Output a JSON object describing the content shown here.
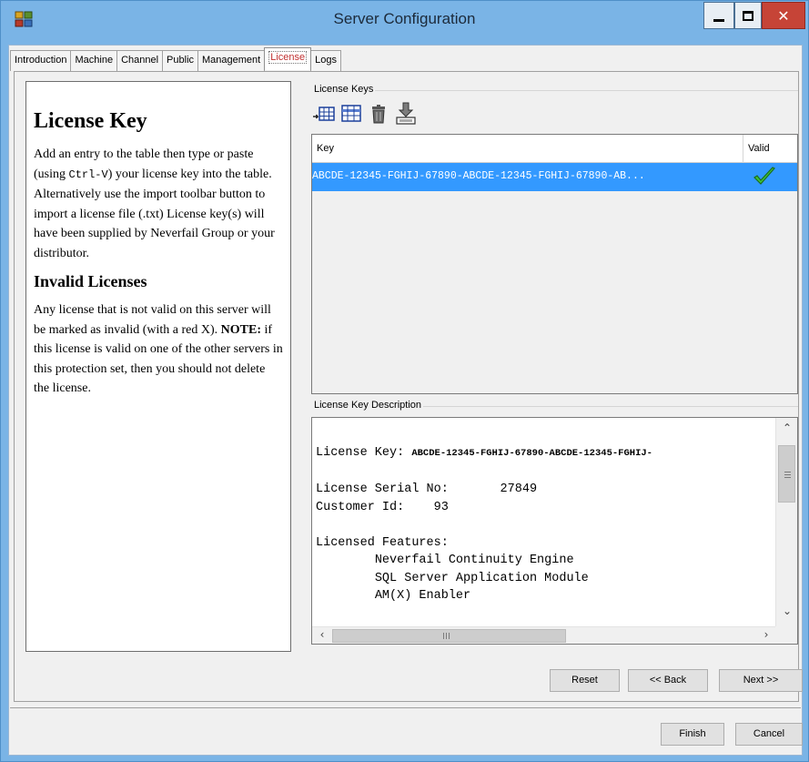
{
  "window": {
    "title": "Server Configuration"
  },
  "tabs": [
    {
      "label": "Introduction"
    },
    {
      "label": "Machine"
    },
    {
      "label": "Channel"
    },
    {
      "label": "Public"
    },
    {
      "label": "Management"
    },
    {
      "label": "License",
      "active": true
    },
    {
      "label": "Logs"
    }
  ],
  "help": {
    "heading": "License Key",
    "intro_1": "Add an entry to the table then type or paste (using ",
    "intro_shortcut": "Ctrl-V",
    "intro_2": ") your license key into the table. Alternatively use the import toolbar button to import a license file (.txt) License key(s) will have been supplied by Neverfail Group or your distributor.",
    "invalid_heading": "Invalid Licenses",
    "invalid_1": "Any license that is not valid on this server will be marked as invalid (with a red X). ",
    "invalid_note": "NOTE:",
    "invalid_2": " if this license is valid on one of the other servers in this protection set, then you should not delete the license."
  },
  "license_keys": {
    "group_label": "License Keys",
    "toolbar": [
      {
        "icon": "add-row-icon"
      },
      {
        "icon": "edit-row-icon"
      },
      {
        "icon": "delete-icon"
      },
      {
        "icon": "import-icon"
      }
    ],
    "columns": {
      "key": "Key",
      "valid": "Valid"
    },
    "rows": [
      {
        "key": "ABCDE-12345-FGHIJ-67890-ABCDE-12345-FGHIJ-67890-AB...",
        "valid": true
      }
    ]
  },
  "description": {
    "group_label": "License Key Description",
    "key_label": "License Key: ",
    "key_value": "ABCDE-12345-FGHIJ-67890-ABCDE-12345-FGHIJ-",
    "serial_line": "License Serial No:       27849",
    "customer_line": "Customer Id:    93",
    "features_label": "Licensed Features:",
    "features": [
      "Neverfail Continuity Engine",
      "SQL Server Application Module",
      "AM(X) Enabler"
    ]
  },
  "buttons": {
    "reset": "Reset",
    "back": "<< Back",
    "next": "Next >>",
    "finish": "Finish",
    "cancel": "Cancel"
  },
  "colors": {
    "title_bar": "#7ab4e6",
    "selection": "#3399ff",
    "active_tab_text": "#c03030",
    "close_button": "#c64437",
    "valid_check": "#3cc43c"
  }
}
